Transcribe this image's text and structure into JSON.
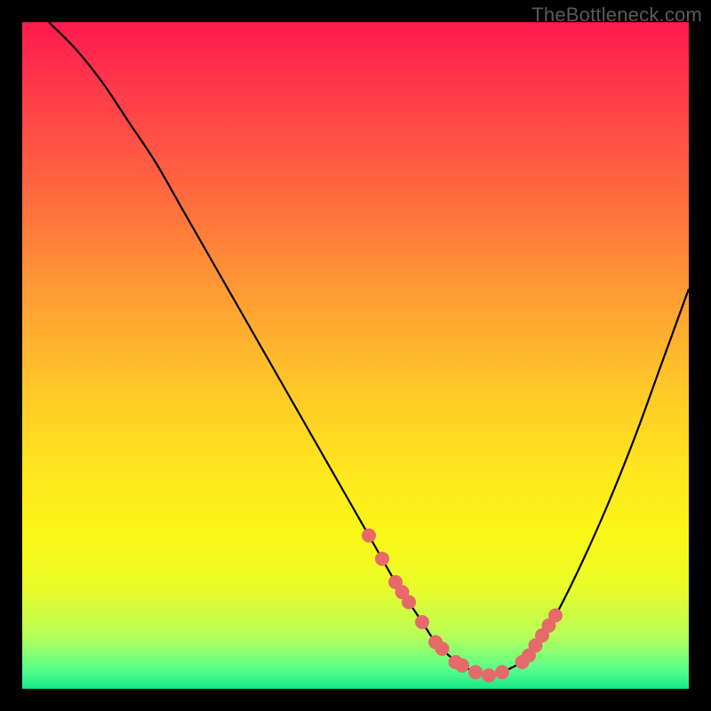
{
  "watermark": "TheBottleneck.com",
  "colors": {
    "background": "#000000",
    "curve_stroke": "#000000",
    "marker_fill": "#e66a6a",
    "marker_stroke": "#cc4e4e"
  },
  "chart_data": {
    "type": "line",
    "title": "",
    "xlabel": "",
    "ylabel": "",
    "xlim": [
      0,
      100
    ],
    "ylim": [
      0,
      100
    ],
    "grid": false,
    "legend": false,
    "x": [
      4,
      8,
      12,
      16,
      20,
      24,
      28,
      32,
      36,
      40,
      44,
      48,
      52,
      56,
      58,
      60,
      62,
      64,
      66,
      68,
      70,
      72,
      76,
      80,
      84,
      88,
      92,
      96,
      100
    ],
    "values": [
      100,
      96,
      91,
      85,
      79,
      72,
      65,
      58,
      51,
      44,
      37,
      30,
      23,
      16,
      13,
      10,
      7,
      5,
      3.5,
      2.5,
      2,
      2.5,
      5,
      11,
      19,
      28,
      38,
      49,
      60
    ],
    "markers": {
      "x": [
        52,
        54,
        56,
        57,
        58,
        60,
        62,
        63,
        65,
        66,
        68,
        70,
        72,
        75,
        76,
        77,
        78,
        79,
        80
      ],
      "y": [
        23,
        19.5,
        16,
        14.5,
        13,
        10,
        7,
        6,
        4,
        3.5,
        2.5,
        2,
        2.5,
        4,
        5,
        6.5,
        8,
        9.5,
        11
      ]
    }
  }
}
